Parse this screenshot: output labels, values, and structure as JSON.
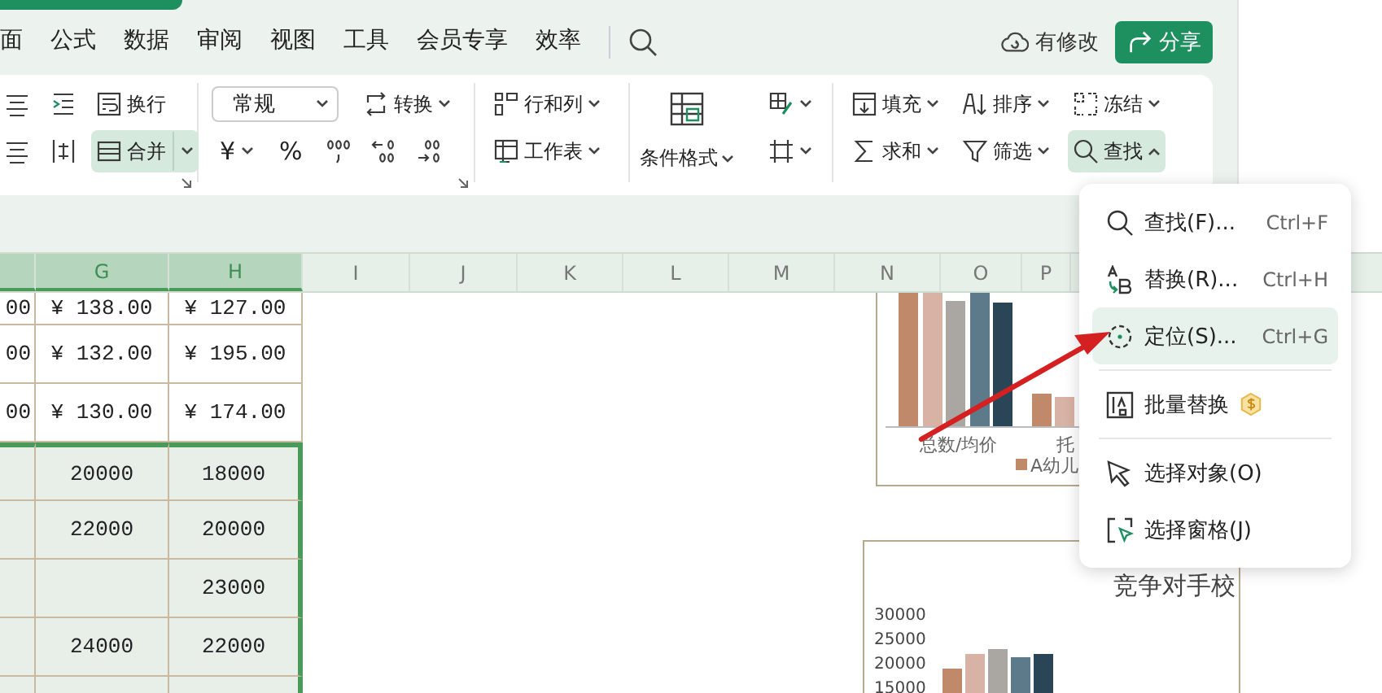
{
  "menu_bar": {
    "tabs": [
      {
        "label": "面",
        "selected": false
      },
      {
        "label": "公式",
        "selected": false
      },
      {
        "label": "数据",
        "selected": false
      },
      {
        "label": "审阅",
        "selected": false
      },
      {
        "label": "视图",
        "selected": false
      },
      {
        "label": "工具",
        "selected": false
      },
      {
        "label": "会员专享",
        "selected": false
      },
      {
        "label": "效率",
        "selected": false
      }
    ],
    "sync_status": "有修改",
    "share_button": "分享"
  },
  "ribbon": {
    "groups": [
      {
        "kind": "rows",
        "launcher": true,
        "rows": [
          [
            {
              "kind": "icon",
              "dropdown": false,
              "active": false
            },
            {
              "kind": "icon",
              "dropdown": false,
              "active": false
            },
            {
              "kind": "button",
              "label": "换行",
              "dropdown": false,
              "active": false
            }
          ],
          [
            {
              "kind": "icon",
              "dropdown": false,
              "active": false
            },
            {
              "kind": "icon",
              "dropdown": false,
              "active": false
            },
            {
              "kind": "split",
              "label": "合并",
              "dropdown": true,
              "active": true
            }
          ]
        ]
      },
      {
        "kind": "rows",
        "launcher": true,
        "rows": [
          [
            {
              "kind": "select",
              "value": "常规",
              "dropdown": true,
              "active": false
            },
            {
              "kind": "button",
              "label": "转换",
              "dropdown": true,
              "active": false
            }
          ],
          [
            {
              "kind": "symbol",
              "label": "¥",
              "dropdown": true,
              "active": false
            },
            {
              "kind": "symbol",
              "label": "%",
              "dropdown": false,
              "active": false
            },
            {
              "kind": "icon",
              "dropdown": false,
              "active": false
            },
            {
              "kind": "icon",
              "dropdown": false,
              "active": false
            },
            {
              "kind": "icon",
              "dropdown": false,
              "active": false
            }
          ]
        ]
      },
      {
        "kind": "rows",
        "rows": [
          [
            {
              "kind": "button",
              "label": "行和列",
              "dropdown": true,
              "active": false
            }
          ],
          [
            {
              "kind": "button",
              "label": "工作表",
              "dropdown": true,
              "active": false
            }
          ]
        ]
      },
      {
        "kind": "big",
        "big": {
          "label": "条件格式",
          "dropdown": true,
          "active": false
        },
        "rows": [
          [
            {
              "kind": "icon",
              "dropdown": true,
              "active": false
            }
          ],
          [
            {
              "kind": "icon",
              "dropdown": true,
              "active": false
            }
          ]
        ]
      },
      {
        "kind": "rows",
        "rows": [
          [
            {
              "kind": "button",
              "label": "填充",
              "dropdown": true,
              "active": false
            },
            {
              "kind": "button",
              "label": "排序",
              "dropdown": true,
              "active": false
            },
            {
              "kind": "button",
              "label": "冻结",
              "dropdown": true,
              "active": false
            }
          ],
          [
            {
              "kind": "button",
              "label": "求和",
              "dropdown": true,
              "active": false
            },
            {
              "kind": "button",
              "label": "筛选",
              "dropdown": true,
              "active": false
            },
            {
              "kind": "button",
              "label": "查找",
              "dropdown": true,
              "active": true
            }
          ]
        ]
      }
    ]
  },
  "sheet": {
    "columns": [
      {
        "selected": true
      },
      {
        "label": "G",
        "selected": true
      },
      {
        "label": "H",
        "selected": true
      },
      {
        "label": "I",
        "selected": false
      },
      {
        "label": "J",
        "selected": false
      },
      {
        "label": "K",
        "selected": false
      },
      {
        "label": "L",
        "selected": false
      },
      {
        "label": "M",
        "selected": false
      },
      {
        "label": "N",
        "selected": false
      },
      {
        "label": "O",
        "selected": false
      },
      {
        "label": "P",
        "selected": false
      }
    ],
    "rows": [
      {
        "selected": false,
        "cells": [
          "00",
          "¥ 138.00",
          "¥ 127.00"
        ]
      },
      {
        "selected": false,
        "cells": [
          "00",
          "¥ 132.00",
          "¥ 195.00"
        ]
      },
      {
        "selected": false,
        "cells": [
          "00",
          "¥ 130.00",
          "¥ 174.00"
        ]
      },
      {
        "selected": true,
        "cells": [
          null,
          "20000",
          "18000"
        ]
      },
      {
        "selected": true,
        "cells": [
          null,
          "22000",
          "20000"
        ]
      },
      {
        "selected": true,
        "cells": [
          null,
          null,
          "23000"
        ]
      },
      {
        "selected": true,
        "cells": [
          null,
          "24000",
          "22000"
        ]
      },
      {
        "selected": true
      }
    ]
  },
  "chart_1": {
    "category_labels": [
      "总数/均价",
      "托"
    ],
    "legend": [
      "A幼儿"
    ]
  },
  "chart_2": {
    "title": "竞争对手校",
    "axis_labels": [
      "30000",
      "25000",
      "20000",
      "15000"
    ]
  },
  "find_menu": {
    "items": [
      {
        "kind": "item",
        "label": "查找(F)...",
        "shortcut": "Ctrl+F",
        "selected": false,
        "vip": false
      },
      {
        "kind": "item",
        "label": "替换(R)...",
        "shortcut": "Ctrl+H",
        "selected": false,
        "vip": false
      },
      {
        "kind": "item",
        "label": "定位(S)...",
        "shortcut": "Ctrl+G",
        "selected": true,
        "vip": false
      },
      {
        "kind": "separator"
      },
      {
        "kind": "item",
        "label": "批量替换",
        "selected": false,
        "vip": true
      },
      {
        "kind": "separator"
      },
      {
        "kind": "item",
        "label": "选择对象(O)",
        "selected": false,
        "vip": false
      },
      {
        "kind": "item",
        "label": "选择窗格(J)",
        "selected": false,
        "vip": false
      }
    ]
  }
}
